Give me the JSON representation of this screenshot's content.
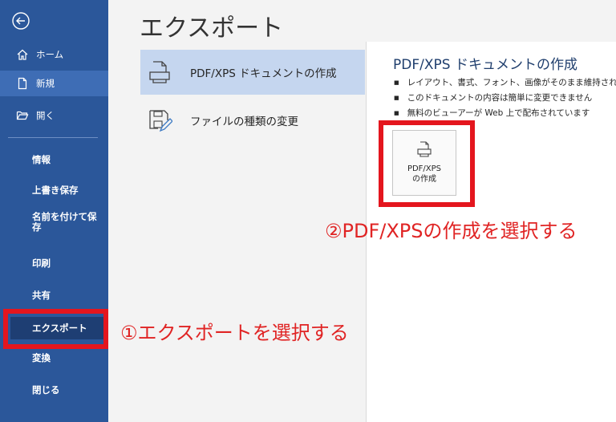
{
  "sidebar": {
    "items": [
      {
        "label": "ホーム",
        "icon": "home-icon"
      },
      {
        "label": "新規",
        "icon": "new-document-icon"
      },
      {
        "label": "開く",
        "icon": "open-folder-icon"
      },
      {
        "label": "情報"
      },
      {
        "label": "上書き保存"
      },
      {
        "label": "名前を付けて保存"
      },
      {
        "label": "印刷"
      },
      {
        "label": "共有"
      },
      {
        "label": "エクスポート"
      },
      {
        "label": "変換"
      },
      {
        "label": "閉じる"
      }
    ],
    "selected": "エクスポート",
    "bg_color": "#2b579a"
  },
  "main": {
    "title": "エクスポート",
    "options": [
      {
        "label": "PDF/XPS ドキュメントの作成",
        "icon": "pdf-document-icon"
      },
      {
        "label": "ファイルの種類の変更",
        "icon": "change-file-type-icon"
      }
    ]
  },
  "detail": {
    "title": "PDF/XPS ドキュメントの作成",
    "bullets": [
      "レイアウト、書式、フォント、画像がそのまま維持されます",
      "このドキュメントの内容は簡単に変更できません",
      "無料のビューアーが Web 上で配布されています"
    ],
    "button_line1": "PDF/XPS",
    "button_line2": "の作成"
  },
  "annotations": {
    "step1": "①エクスポートを選択する",
    "step2": "②PDF/XPSの作成を選択する",
    "highlight_color": "#e4161e"
  }
}
